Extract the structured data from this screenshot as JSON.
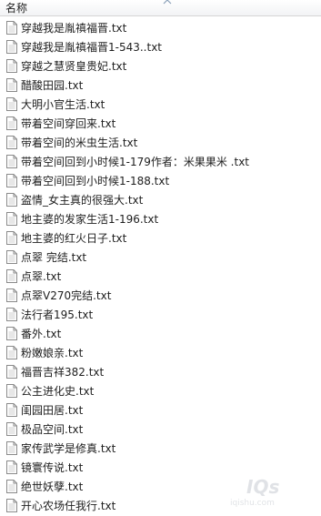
{
  "header": {
    "name_column": "名称"
  },
  "files": [
    "穿越我是胤禛福晋.txt",
    "穿越我是胤禛福晋1-543..txt",
    "穿越之慧贤皇贵妃.txt",
    "醋酸田园.txt",
    "大明小官生活.txt",
    "带着空间穿回来.txt",
    "带着空间的米虫生活.txt",
    "带着空间回到小时候1-179作者：米果果米 .txt",
    "带着空间回到小时候1-188.txt",
    "盗情_女主真的很强大.txt",
    "地主婆的发家生活1-196.txt",
    "地主婆的红火日子.txt",
    "点翠 完结.txt",
    "点翠.txt",
    "点翠V270完结.txt",
    "法行者195.txt",
    "番外.txt",
    "粉嫩娘亲.txt",
    "福晋吉祥382.txt",
    "公主进化史.txt",
    "闺园田居.txt",
    "极品空间.txt",
    "家传武学是修真.txt",
    "镜寰传说.txt",
    "绝世妖孽.txt",
    "开心农场任我行.txt"
  ]
}
